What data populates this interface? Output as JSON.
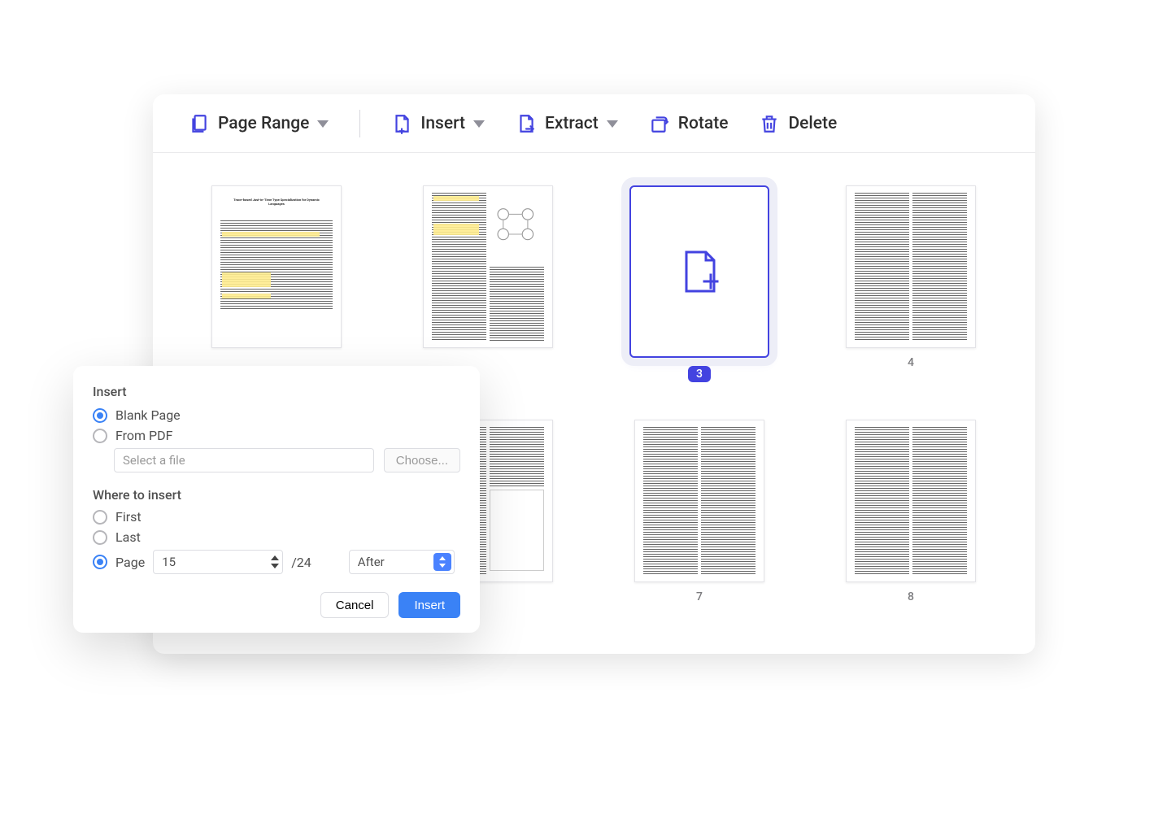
{
  "toolbar": {
    "page_range": "Page Range",
    "insert": "Insert",
    "extract": "Extract",
    "rotate": "Rotate",
    "delete": "Delete"
  },
  "thumbnails": {
    "p3_label": "3",
    "p4_label": "4",
    "p7_label": "7",
    "p8_label": "8"
  },
  "dialog": {
    "title": "Insert",
    "blank_page": "Blank Page",
    "from_pdf": "From PDF",
    "file_placeholder": "Select a file",
    "choose": "Choose...",
    "where_title": "Where to insert",
    "first": "First",
    "last": "Last",
    "page_label": "Page",
    "page_value": "15",
    "page_total": "/24",
    "position_value": "After",
    "cancel": "Cancel",
    "insert_btn": "Insert"
  }
}
